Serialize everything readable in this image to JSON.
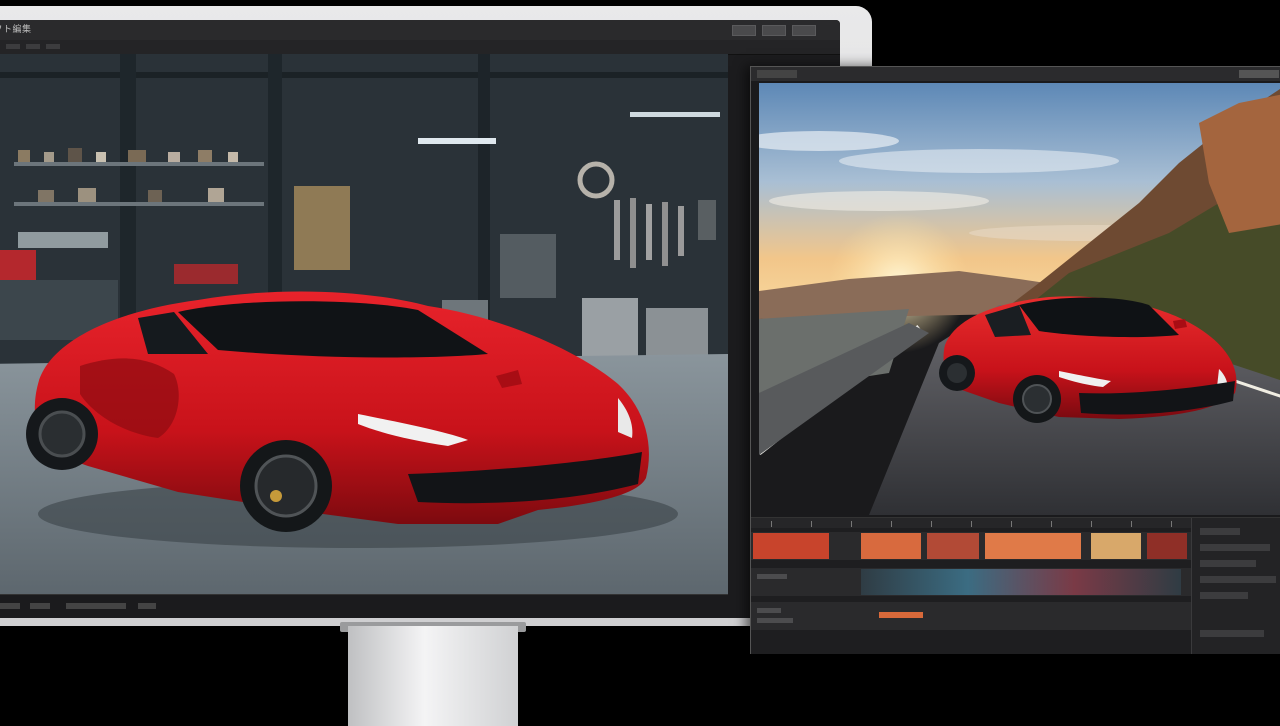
{
  "monitor": {
    "app_title": "ソフト編集",
    "window_buttons": [
      "minimize",
      "maximize",
      "close"
    ]
  },
  "garage_scene": {
    "icons": [
      "wrench-icon",
      "tool-cabinet-icon"
    ]
  },
  "editor": {
    "tabs": [
      "preview"
    ],
    "timeline": {
      "clip_colors": [
        "#c8442c",
        "#d86a3e",
        "#b24a36",
        "#e07a48",
        "#d8a86a",
        "#8f2f27"
      ]
    }
  },
  "colors": {
    "car_red": "#c8121a",
    "app_background": "#1c1c1e",
    "monitor_bezel": "#e2e2e3"
  }
}
